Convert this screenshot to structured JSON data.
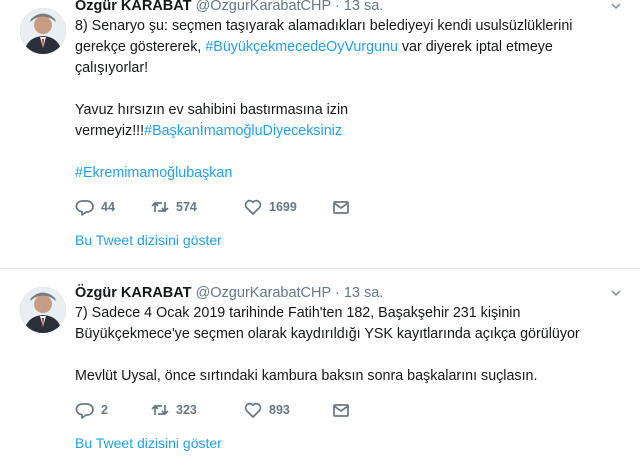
{
  "tweets": [
    {
      "author_name": "Özgür KARABAT",
      "author_handle": "@OzgurKarabatCHP",
      "separator": "·",
      "time": "13 sa.",
      "text_1a": "8) Senaryo şu: seçmen taşıyarak alamadıkları belediyeyi kendi usulsüzlüklerini",
      "text_1b_pre": "gerekçe göstererek, ",
      "text_1b_tag": "#BüyükçekmecedeOyVurgunu",
      "text_1b_post": " var diyerek iptal etmeye",
      "text_1c": "çalışıyorlar!",
      "text_2a": "Yavuz hırsızın ev sahibini bastırmasına izin",
      "text_2b_pre": "vermeyiz!!!",
      "text_2b_tag": "#BaşkanİmamoğluDiyeceksiniz",
      "text_3_tag": "#Ekremimamoğlubaşkan",
      "replies": "44",
      "retweets": "574",
      "likes": "1699",
      "show_thread": "Bu Tweet dizisini göster"
    },
    {
      "author_name": "Özgür KARABAT",
      "author_handle": "@OzgurKarabatCHP",
      "separator": "·",
      "time": "13 sa.",
      "text_1a": "7) Sadece 4 Ocak 2019 tarihinde Fatih'ten 182, Başakşehir 231 kişinin",
      "text_1b": "Büyükçekmece'ye seçmen olarak kaydırıldığı YSK kayıtlarında açıkça görülüyor",
      "text_2a": "Mevlüt Uysal, önce sırtındaki kambura baksın sonra başkalarını suçlasın.",
      "replies": "2",
      "retweets": "323",
      "likes": "893",
      "show_thread": "Bu Tweet dizisini göster"
    }
  ],
  "colors": {
    "link": "#1da1f2",
    "muted": "#657786",
    "divider": "#e1e8ed"
  },
  "icons": [
    "avatar",
    "chevron-down-icon",
    "reply-icon",
    "retweet-icon",
    "like-icon",
    "message-icon"
  ]
}
